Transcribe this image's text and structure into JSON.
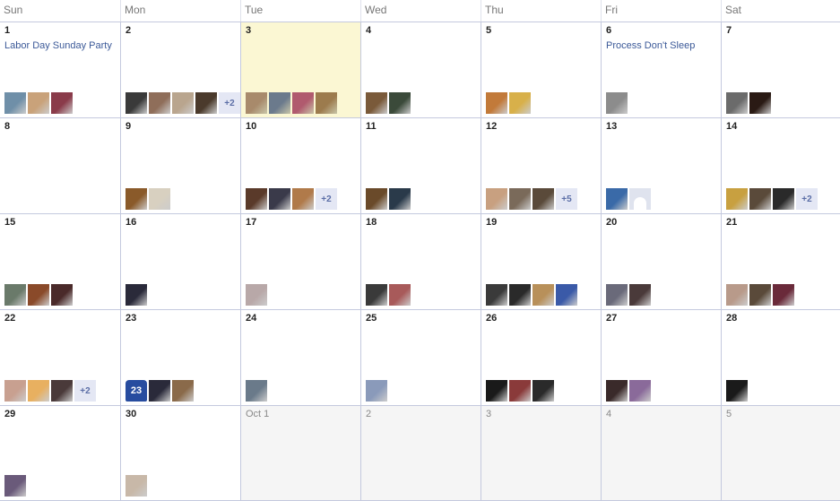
{
  "weekdays": [
    "Sun",
    "Mon",
    "Tue",
    "Wed",
    "Thu",
    "Fri",
    "Sat"
  ],
  "more_labels": {
    "plus2": "+2",
    "plus5": "+5"
  },
  "weeks": [
    [
      {
        "label": "1",
        "event": "Labor Day Sunday Party"
      },
      {
        "label": "2"
      },
      {
        "label": "3",
        "today": true
      },
      {
        "label": "4"
      },
      {
        "label": "5"
      },
      {
        "label": "6",
        "event": "Process Don't Sleep"
      },
      {
        "label": "7"
      }
    ],
    [
      {
        "label": "8"
      },
      {
        "label": "9"
      },
      {
        "label": "10"
      },
      {
        "label": "11"
      },
      {
        "label": "12"
      },
      {
        "label": "13"
      },
      {
        "label": "14"
      }
    ],
    [
      {
        "label": "15"
      },
      {
        "label": "16"
      },
      {
        "label": "17"
      },
      {
        "label": "18"
      },
      {
        "label": "19"
      },
      {
        "label": "20"
      },
      {
        "label": "21"
      }
    ],
    [
      {
        "label": "22"
      },
      {
        "label": "23",
        "jersey": "23"
      },
      {
        "label": "24"
      },
      {
        "label": "25"
      },
      {
        "label": "26"
      },
      {
        "label": "27"
      },
      {
        "label": "28"
      }
    ],
    [
      {
        "label": "29"
      },
      {
        "label": "30"
      },
      {
        "label": "Oct 1",
        "other": true
      },
      {
        "label": "2",
        "other": true
      },
      {
        "label": "3",
        "other": true
      },
      {
        "label": "4",
        "other": true
      },
      {
        "label": "5",
        "other": true
      }
    ]
  ],
  "avatar_colors": {
    "w0": [
      [
        "#6f8fa8",
        "#c9a27a",
        "#8a3b4a"
      ],
      [
        "#3a3a3a",
        "#8f6e5a",
        "#b9a58e",
        "#4b3a2c"
      ],
      [
        "#a88a6b",
        "#6b7a8c",
        "#b05a6e",
        "#9c7b4d"
      ],
      [
        "#7a5a3a",
        "#3b4a3a"
      ],
      [
        "#c27a3a",
        "#d8b04a"
      ],
      [
        "#8c8c8c"
      ],
      [
        "#6b6b6b",
        "#2a1a14"
      ]
    ],
    "w1": [
      [],
      [
        "#8a5a2a",
        "#d8d0c0"
      ],
      [
        "#5a3a2a",
        "#3a3a4a",
        "#b07a4a"
      ],
      [
        "#6a4a2a",
        "#2a3a4a"
      ],
      [
        "#c8a080",
        "#7a6a5a",
        "#5a4a3a"
      ],
      [
        "#3a6aa8"
      ],
      [
        "#c8a040",
        "#5a4a3a",
        "#2a2a2a"
      ]
    ],
    "w2": [
      [
        "#6a7a6a",
        "#8a4a2a",
        "#4a2a2a"
      ],
      [
        "#2a2a3a"
      ],
      [
        "#b8a8a8"
      ],
      [
        "#3a3a3a",
        "#a85a5a"
      ],
      [
        "#3a3a3a",
        "#2a2a2a",
        "#b8905a",
        "#3a5aa8"
      ],
      [
        "#6a6a7a",
        "#4a3a3a"
      ],
      [
        "#b89a8a",
        "#5a4a3a",
        "#6a2a3a"
      ]
    ],
    "w3": [
      [
        "#c8a090",
        "#e8b060",
        "#4a3a3a"
      ],
      [
        "#2a2a3a",
        "#8a6a4a"
      ],
      [
        "#6a7a8a"
      ],
      [
        "#8a9aba"
      ],
      [
        "#1a1a1a",
        "#8a3a3a",
        "#2a2a2a"
      ],
      [
        "#3a2a2a",
        "#8a6a9a"
      ],
      [
        "#1a1a1a"
      ]
    ],
    "w4": [
      [
        "#6a5a7a"
      ],
      [
        "#c8b8a8"
      ],
      [],
      [],
      [],
      [],
      []
    ]
  },
  "cells_more": {
    "w0c1": "+2",
    "w1c2": "+2",
    "w1c4": "+5",
    "w1c6": "+2",
    "w3c0": "+2"
  },
  "blank_profile_cell": "w1c5"
}
